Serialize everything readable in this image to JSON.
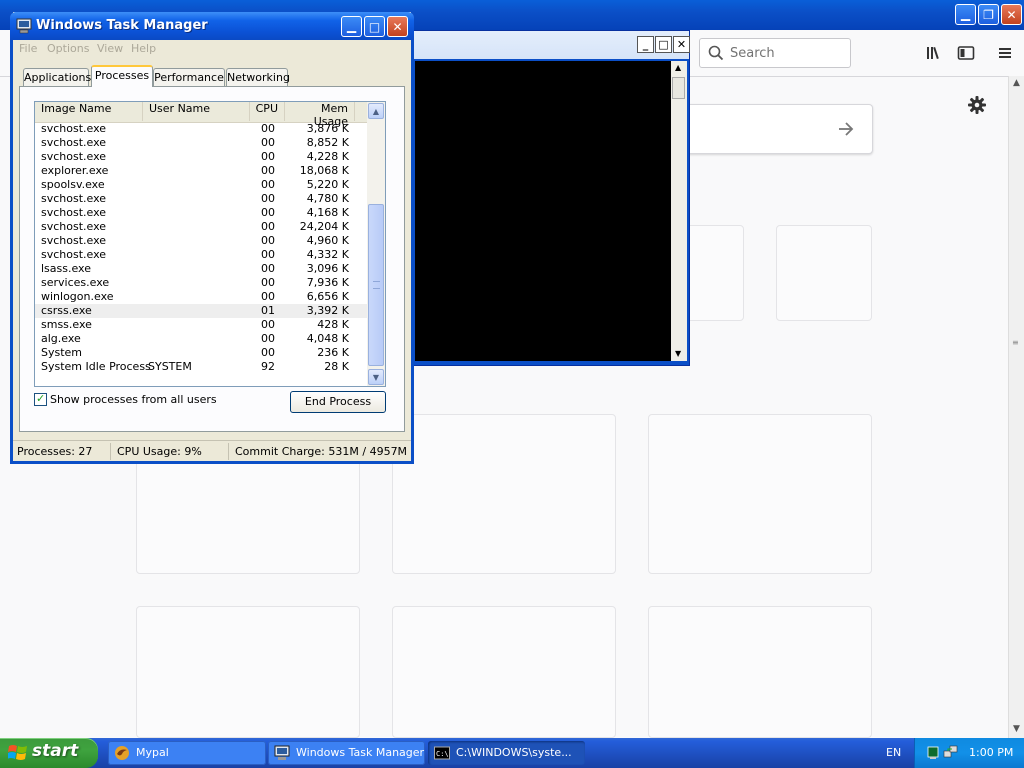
{
  "browser": {
    "search_placeholder": "Search"
  },
  "console": {
    "taskbar_label": "C:\\WINDOWS\\syste..."
  },
  "taskmgr": {
    "title": "Windows Task Manager",
    "menu": [
      "File",
      "Options",
      "View",
      "Help"
    ],
    "tabs": [
      "Applications",
      "Processes",
      "Performance",
      "Networking"
    ],
    "active_tab": "Processes",
    "columns": [
      "Image Name",
      "User Name",
      "CPU",
      "Mem Usage"
    ],
    "processes": [
      {
        "image": "svchost.exe",
        "user": "",
        "cpu": "00",
        "mem": "3,876 K"
      },
      {
        "image": "svchost.exe",
        "user": "",
        "cpu": "00",
        "mem": "8,852 K"
      },
      {
        "image": "svchost.exe",
        "user": "",
        "cpu": "00",
        "mem": "4,228 K"
      },
      {
        "image": "explorer.exe",
        "user": "",
        "cpu": "00",
        "mem": "18,068 K"
      },
      {
        "image": "spoolsv.exe",
        "user": "",
        "cpu": "00",
        "mem": "5,220 K"
      },
      {
        "image": "svchost.exe",
        "user": "",
        "cpu": "00",
        "mem": "4,780 K"
      },
      {
        "image": "svchost.exe",
        "user": "",
        "cpu": "00",
        "mem": "4,168 K"
      },
      {
        "image": "svchost.exe",
        "user": "",
        "cpu": "00",
        "mem": "24,204 K"
      },
      {
        "image": "svchost.exe",
        "user": "",
        "cpu": "00",
        "mem": "4,960 K"
      },
      {
        "image": "svchost.exe",
        "user": "",
        "cpu": "00",
        "mem": "4,332 K"
      },
      {
        "image": "lsass.exe",
        "user": "",
        "cpu": "00",
        "mem": "3,096 K"
      },
      {
        "image": "services.exe",
        "user": "",
        "cpu": "00",
        "mem": "7,936 K"
      },
      {
        "image": "winlogon.exe",
        "user": "",
        "cpu": "00",
        "mem": "6,656 K"
      },
      {
        "image": "csrss.exe",
        "user": "",
        "cpu": "01",
        "mem": "3,392 K",
        "selected": true
      },
      {
        "image": "smss.exe",
        "user": "",
        "cpu": "00",
        "mem": "428 K"
      },
      {
        "image": "alg.exe",
        "user": "",
        "cpu": "00",
        "mem": "4,048 K"
      },
      {
        "image": "System",
        "user": "",
        "cpu": "00",
        "mem": "236 K"
      },
      {
        "image": "System Idle Process",
        "user": "SYSTEM",
        "cpu": "92",
        "mem": "28 K"
      }
    ],
    "show_all_label": "Show processes from all users",
    "show_all_checked": true,
    "end_process_label": "End Process",
    "status": {
      "processes": "Processes: 27",
      "cpu": "CPU Usage: 9%",
      "commit": "Commit Charge: 531M / 4957M"
    }
  },
  "taskbar": {
    "start_label": "start",
    "tasks": [
      {
        "label": "Mypal",
        "active": false
      },
      {
        "label": "Windows Task Manager",
        "active": false
      },
      {
        "label": "C:\\WINDOWS\\syste...",
        "active": true
      }
    ],
    "language": "EN",
    "clock": "1:00 PM"
  },
  "colors": {
    "xp_blue": "#0b4fc7",
    "start_green": "#3fa33f",
    "tray_blue": "#1290e8"
  }
}
